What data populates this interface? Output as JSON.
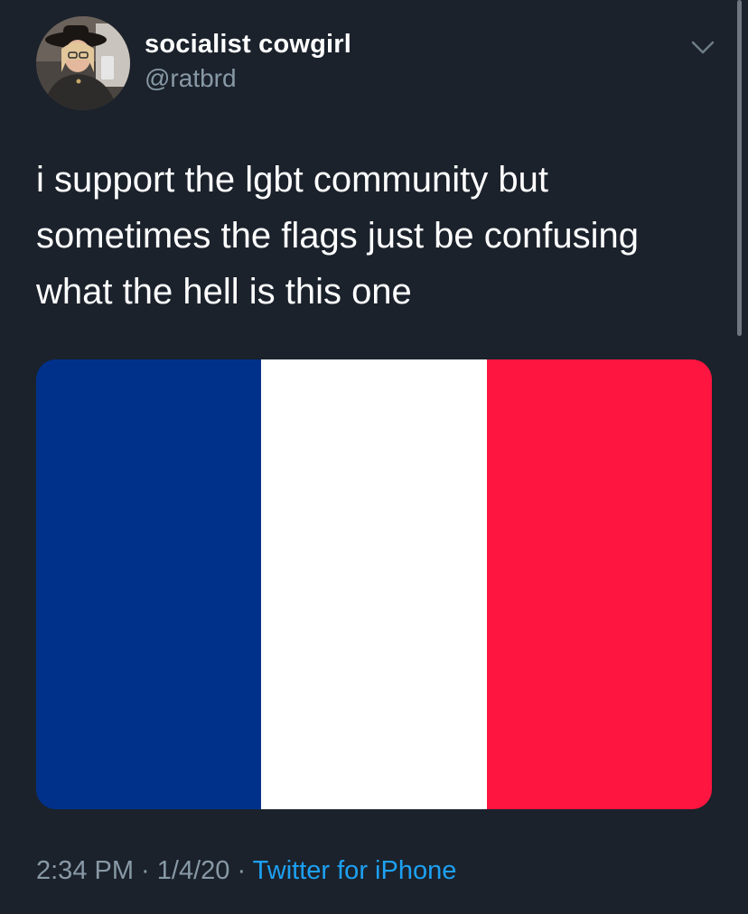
{
  "user": {
    "display_name": "socialist cowgirl",
    "handle": "@ratbrd"
  },
  "tweet": {
    "lines": [
      "i support the lgbt community but",
      "sometimes the flags just be confusing",
      "what the hell is this one"
    ],
    "media": {
      "stripes": [
        {
          "color": "#00318a"
        },
        {
          "color": "#ffffff"
        },
        {
          "color": "#fe1540"
        }
      ]
    }
  },
  "meta": {
    "time": "2:34 PM",
    "separator": " · ",
    "date": "1/4/20",
    "source": "Twitter for iPhone"
  },
  "icons": {
    "menu": "chevron-down-icon"
  },
  "colors": {
    "background": "#1b222c",
    "secondary_text": "#8899a6",
    "link": "#1da1f2"
  }
}
